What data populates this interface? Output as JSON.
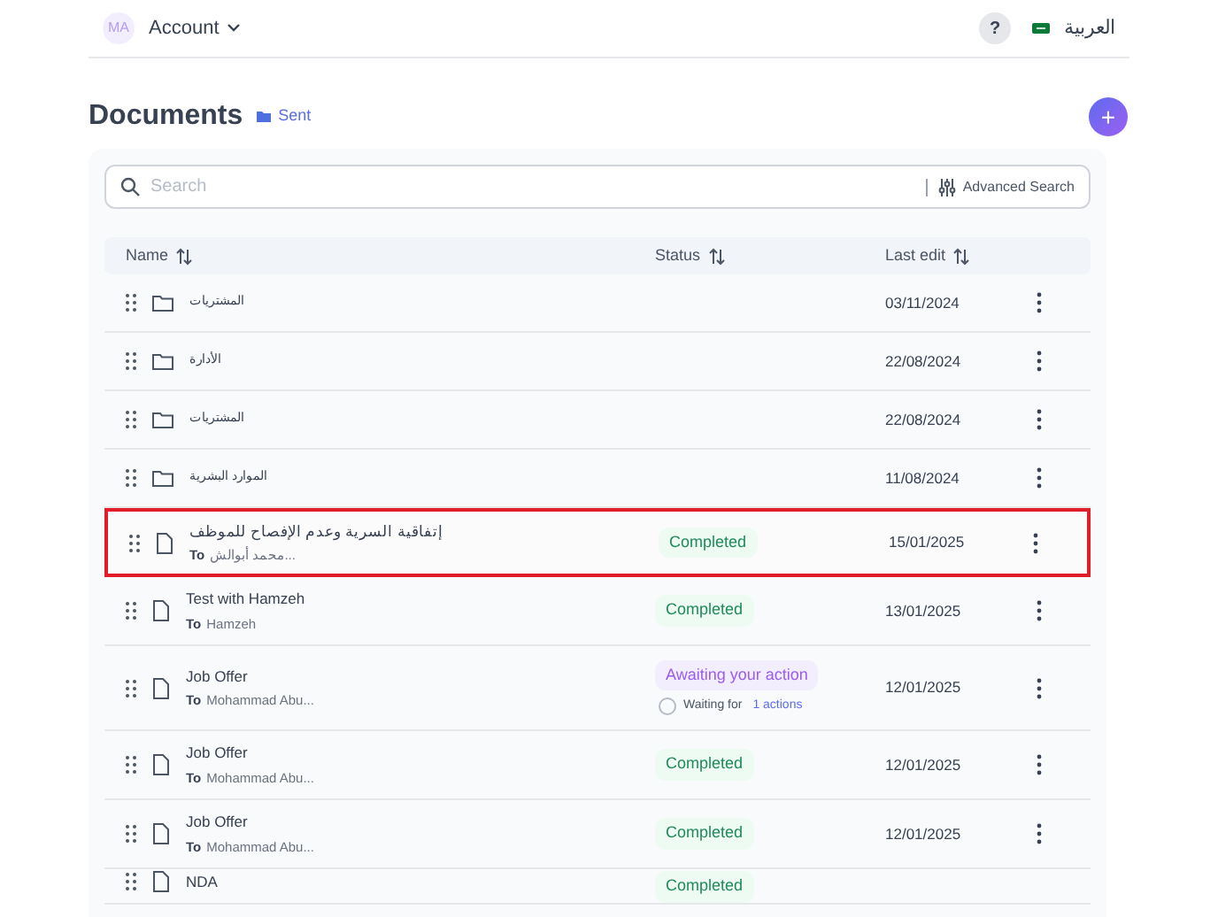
{
  "header": {
    "avatar": "MA",
    "account": "Account",
    "language": "العربية",
    "help": "?"
  },
  "page": {
    "title": "Documents",
    "folder": "Sent",
    "add": "+"
  },
  "search": {
    "placeholder": "Search",
    "advanced": "Advanced Search"
  },
  "table": {
    "columns": [
      "Name",
      "Status",
      "Last edit"
    ],
    "rows": [
      {
        "kind": "folder",
        "name": "المشتريات",
        "date": "03/11/2024",
        "highlighted": false
      },
      {
        "kind": "folder",
        "name": "الأدارة",
        "date": "22/08/2024",
        "highlighted": false
      },
      {
        "kind": "folder",
        "name": "المشتريات",
        "date": "22/08/2024",
        "highlighted": false
      },
      {
        "kind": "folder",
        "name": "الموارد البشرية",
        "date": "11/08/2024",
        "highlighted": false
      },
      {
        "kind": "document",
        "name": "إتفاقية السرية وعدم الإفصاح للموظف",
        "to_label": "To",
        "recipient": "محمد أبوالش...",
        "status": {
          "kind": "completed",
          "label": "Completed"
        },
        "date": "15/01/2025",
        "highlighted": true
      },
      {
        "kind": "document",
        "name": "Test with Hamzeh",
        "to_label": "To",
        "recipient": "Hamzeh",
        "status": {
          "kind": "completed",
          "label": "Completed"
        },
        "date": "13/01/2025",
        "highlighted": false
      },
      {
        "kind": "document",
        "name": "Job Offer",
        "to_label": "To",
        "recipient": "Mohammad Abu...",
        "status": {
          "kind": "awaiting",
          "label": "Awaiting your action",
          "waiting": "Waiting for",
          "actions": "1 actions"
        },
        "date": "12/01/2025",
        "highlighted": false
      },
      {
        "kind": "document",
        "name": "Job Offer",
        "to_label": "To",
        "recipient": "Mohammad Abu...",
        "status": {
          "kind": "completed",
          "label": "Completed"
        },
        "date": "12/01/2025",
        "highlighted": false
      },
      {
        "kind": "document",
        "name": "Job Offer",
        "to_label": "To",
        "recipient": "Mohammad Abu...",
        "status": {
          "kind": "completed",
          "label": "Completed"
        },
        "date": "12/01/2025",
        "highlighted": false
      },
      {
        "kind": "document",
        "name": "NDA",
        "status": {
          "kind": "completed",
          "label": "Completed"
        },
        "highlighted": false
      }
    ]
  }
}
